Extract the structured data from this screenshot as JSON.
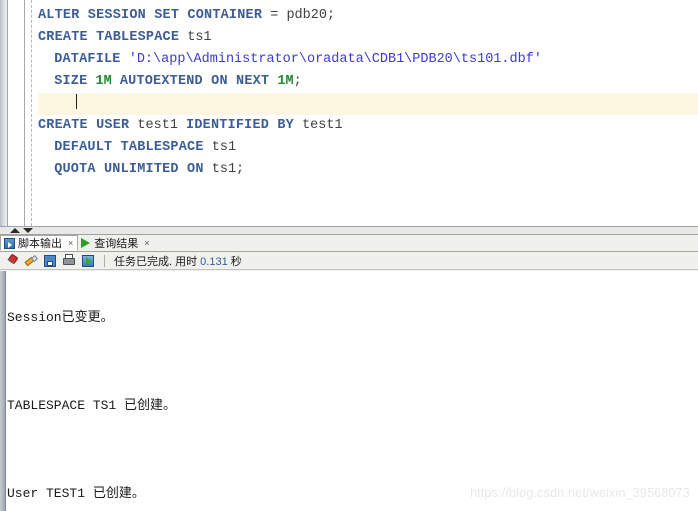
{
  "editor": {
    "lines": [
      {
        "indent": 0,
        "current": false,
        "tokens": [
          {
            "t": "kw",
            "v": "ALTER SESSION SET CONTAINER"
          },
          {
            "t": "pun",
            "v": " = "
          },
          {
            "t": "id",
            "v": "pdb20;"
          }
        ]
      },
      {
        "indent": 0,
        "current": false,
        "tokens": [
          {
            "t": "kw",
            "v": "CREATE TABLESPACE"
          },
          {
            "t": "id",
            "v": " ts1"
          }
        ]
      },
      {
        "indent": 1,
        "current": false,
        "tokens": [
          {
            "t": "kw",
            "v": "DATAFILE"
          },
          {
            "t": "pun",
            "v": " "
          },
          {
            "t": "str",
            "v": "'D:\\app\\Administrator\\oradata\\CDB1\\PDB20\\ts101.dbf'"
          }
        ]
      },
      {
        "indent": 1,
        "current": false,
        "tokens": [
          {
            "t": "kw",
            "v": "SIZE"
          },
          {
            "t": "pun",
            "v": " "
          },
          {
            "t": "num",
            "v": "1M"
          },
          {
            "t": "pun",
            "v": " "
          },
          {
            "t": "kw",
            "v": "AUTOEXTEND ON NEXT"
          },
          {
            "t": "pun",
            "v": " "
          },
          {
            "t": "num",
            "v": "1M"
          },
          {
            "t": "pun",
            "v": ";"
          }
        ]
      },
      {
        "indent": 1,
        "current": true,
        "tokens": []
      },
      {
        "indent": 0,
        "current": false,
        "tokens": [
          {
            "t": "kw",
            "v": "CREATE USER"
          },
          {
            "t": "id",
            "v": " test1 "
          },
          {
            "t": "kw",
            "v": "IDENTIFIED BY"
          },
          {
            "t": "id",
            "v": " test1"
          }
        ]
      },
      {
        "indent": 1,
        "current": false,
        "tokens": [
          {
            "t": "kw",
            "v": "DEFAULT TABLESPACE"
          },
          {
            "t": "id",
            "v": " ts1"
          }
        ]
      },
      {
        "indent": 1,
        "current": false,
        "tokens": [
          {
            "t": "kw",
            "v": "QUOTA UNLIMITED ON"
          },
          {
            "t": "id",
            "v": " ts1"
          },
          {
            "t": "pun",
            "v": ";"
          }
        ]
      }
    ]
  },
  "output_panel": {
    "tabs": [
      {
        "label": "脚本输出",
        "icon": "script-output-icon",
        "close": "×",
        "active": true
      },
      {
        "label": "查询结果",
        "icon": "query-result-play-icon",
        "close": "×",
        "active": false
      }
    ],
    "toolbar": {
      "buttons": [
        {
          "name": "pin-button",
          "icon": "pin-icon"
        },
        {
          "name": "clear-button",
          "icon": "eraser-icon"
        },
        {
          "name": "save-button",
          "icon": "floppy-disk-icon"
        },
        {
          "name": "print-button",
          "icon": "printer-icon"
        },
        {
          "name": "run-button",
          "icon": "run-play-icon"
        }
      ],
      "status_prefix": "任务已完成. 用时 ",
      "status_number": "0.131",
      "status_suffix": " 秒"
    },
    "console_lines": [
      "",
      "Session已变更。",
      "",
      "",
      "",
      "TABLESPACE TS1 已创建。",
      "",
      "",
      "",
      "User TEST1 已创建。"
    ]
  },
  "watermark": {
    "text": "https://blog.csdn.net/weixin_39568073"
  },
  "colors": {
    "keyword": "#3c5d96",
    "string": "#3b3bd4",
    "number": "#1f8a2e",
    "identifier": "#404040",
    "current_line_highlight": "#fdf6e0",
    "panel_bg": "#f0f0ec"
  }
}
